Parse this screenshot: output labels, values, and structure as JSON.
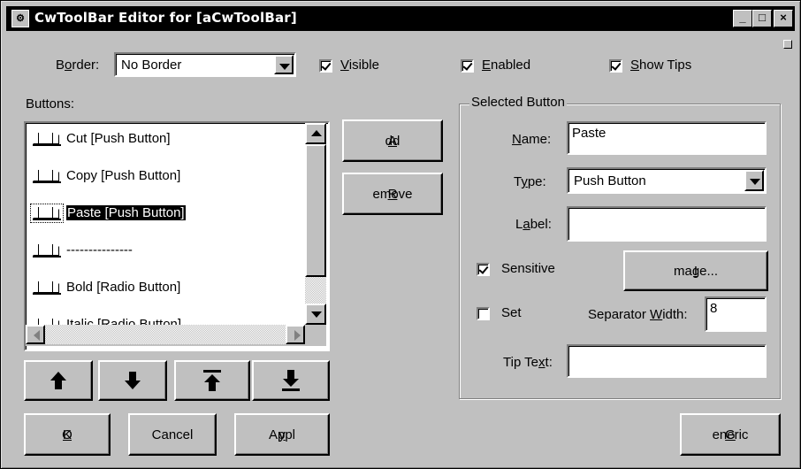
{
  "window": {
    "title": "CwToolBar Editor for [aCwToolBar]",
    "controls": {
      "minimize": "_",
      "maximize": "□",
      "close": "×"
    }
  },
  "top": {
    "border_label_pre": "B",
    "border_label_u": "o",
    "border_label_post": "rder:",
    "border_value": "No Border",
    "visible": {
      "u": "V",
      "rest": "isible",
      "checked": true
    },
    "enabled": {
      "u": "E",
      "rest": "nabled",
      "checked": true
    },
    "show_tips": {
      "pre": "",
      "u": "S",
      "rest": "how Tips",
      "checked": true
    }
  },
  "buttons_list": {
    "label": "Buttons:",
    "items": [
      {
        "label": "Cut [Push Button]",
        "selected": false
      },
      {
        "label": "Copy [Push Button]",
        "selected": false
      },
      {
        "label": "Paste [Push Button]",
        "selected": true
      },
      {
        "label": "---------------",
        "selected": false
      },
      {
        "label": "Bold [Radio Button]",
        "selected": false
      },
      {
        "label": "Italic [Radio Button]",
        "selected": false
      }
    ]
  },
  "actions": {
    "add_u": "A",
    "add_rest": "dd",
    "remove_u": "R",
    "remove_rest": "emove"
  },
  "selected_button": {
    "title": "Selected Button",
    "name_u": "N",
    "name_rest": "ame:",
    "name_value": "Paste",
    "type_pre": "T",
    "type_u": "y",
    "type_rest": "pe:",
    "type_value": "Push Button",
    "label_pre": "L",
    "label_u": "a",
    "label_rest": "bel:",
    "label_value": "",
    "sensitive_label": "Sensitive",
    "sensitive_checked": true,
    "image_u": "I",
    "image_rest": "mage...",
    "set_label": "Set",
    "set_checked": false,
    "sepwidth_pre": "Separator ",
    "sepwidth_u": "W",
    "sepwidth_rest": "idth:",
    "sepwidth_value": "8",
    "tip_pre": "Tip Te",
    "tip_u": "x",
    "tip_rest": "t:",
    "tip_value": ""
  },
  "footer": {
    "ok_pre": "O",
    "ok_u": "K",
    "cancel": "Cancel",
    "apply_pre": "Appl",
    "apply_u": "y",
    "generic_u": "G",
    "generic_rest": "eneric"
  },
  "move_buttons": [
    "arrow-up-icon",
    "arrow-down-icon",
    "arrow-to-top-icon",
    "arrow-to-bottom-icon"
  ]
}
